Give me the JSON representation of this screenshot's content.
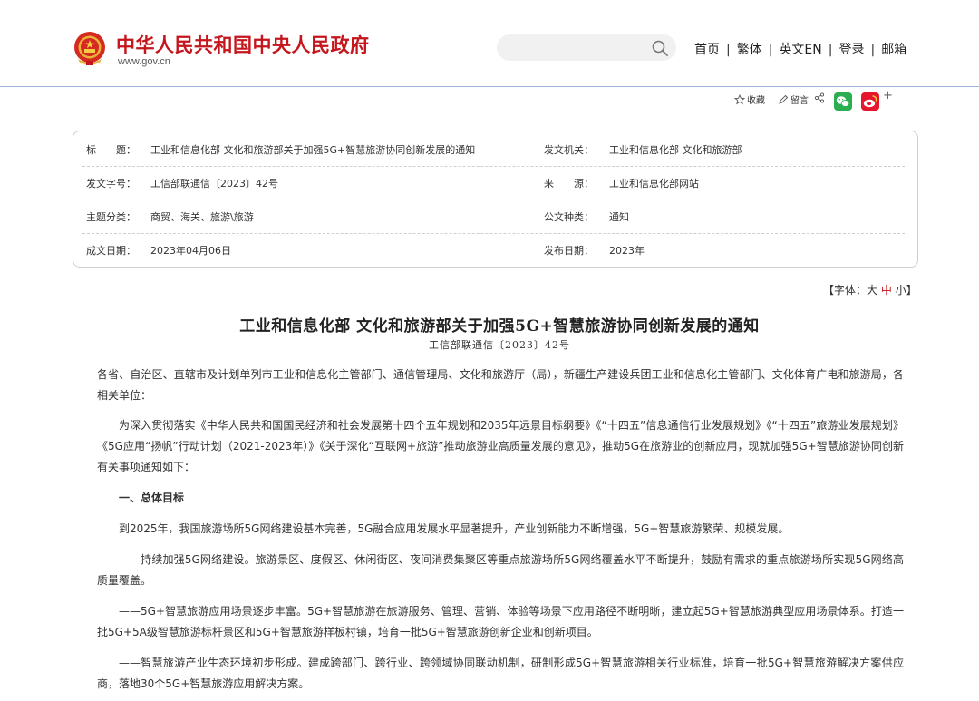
{
  "header": {
    "site_title": "中华人民共和国中央人民政府",
    "site_url": "www.gov.cn",
    "search_placeholder": "",
    "nav": [
      "首页",
      "繁体",
      "英文EN",
      "登录",
      "邮箱"
    ]
  },
  "share": {
    "collect_label": "收藏",
    "comment_label": "留言",
    "plus_label": "+"
  },
  "meta": {
    "title_label": "标　　题：",
    "title_value": "工业和信息化部 文化和旅游部关于加强5G+智慧旅游协同创新发展的通知",
    "issuer_label": "发文机关：",
    "issuer_value": "工业和信息化部 文化和旅游部",
    "docno_label": "发文字号：",
    "docno_value": "工信部联通信〔2023〕42号",
    "source_label": "来　　源：",
    "source_value": "工业和信息化部网站",
    "topic_label": "主题分类：",
    "topic_value": "商贸、海关、旅游\\旅游",
    "type_label": "公文种类：",
    "type_value": "通知",
    "date_label": "成文日期：",
    "date_value": "2023年04月06日",
    "pub_label": "发布日期：",
    "pub_value": "2023年"
  },
  "font_size": {
    "prefix": "【字体：",
    "large": "大",
    "medium": "中",
    "small": "小",
    "suffix": "】"
  },
  "doc": {
    "title": "工业和信息化部  文化和旅游部关于加强5G+智慧旅游协同创新发展的通知",
    "number": "工信部联通信〔2023〕42号"
  },
  "content": {
    "p1": "各省、自治区、直辖市及计划单列市工业和信息化主管部门、通信管理局、文化和旅游厅（局），新疆生产建设兵团工业和信息化主管部门、文化体育广电和旅游局，各相关单位：",
    "p2": "为深入贯彻落实《中华人民共和国国民经济和社会发展第十四个五年规划和2035年远景目标纲要》《“十四五”信息通信行业发展规划》《“十四五”旅游业发展规划》《5G应用“扬帆”行动计划（2021-2023年）》《关于深化“互联网+旅游”推动旅游业高质量发展的意见》，推动5G在旅游业的创新应用，现就加强5G+智慧旅游协同创新有关事项通知如下：",
    "h1": "一、总体目标",
    "p3": "到2025年，我国旅游场所5G网络建设基本完善，5G融合应用发展水平显著提升，产业创新能力不断增强，5G+智慧旅游繁荣、规模发展。",
    "p4": "——持续加强5G网络建设。旅游景区、度假区、休闲街区、夜间消费集聚区等重点旅游场所5G网络覆盖水平不断提升，鼓励有需求的重点旅游场所实现5G网络高质量覆盖。",
    "p5": "——5G+智慧旅游应用场景逐步丰富。5G+智慧旅游在旅游服务、管理、营销、体验等场景下应用路径不断明晰，建立起5G+智慧旅游典型应用场景体系。打造一批5G+5A级智慧旅游标杆景区和5G+智慧旅游样板村镇，培育一批5G+智慧旅游创新企业和创新项目。",
    "p6": "——智慧旅游产业生态环境初步形成。建成跨部门、跨行业、跨领域协同联动机制，研制形成5G+智慧旅游相关行业标准，培育一批5G+智慧旅游解决方案供应商，落地30个5G+智慧旅游应用解决方案。"
  },
  "colors": {
    "brand_red": "#c4161c",
    "header_rule": "#9bb8d6",
    "wechat_green": "#2aae4f",
    "weibo_red": "#e6162d"
  }
}
